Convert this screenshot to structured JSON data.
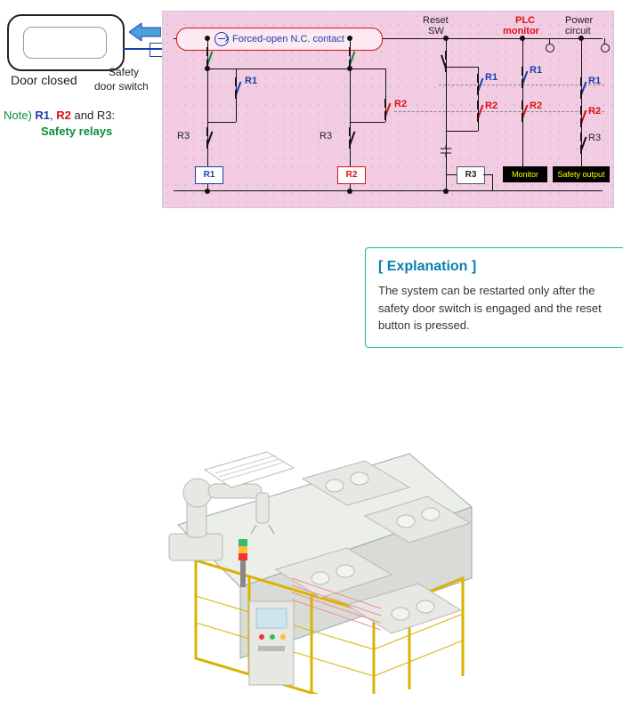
{
  "door": {
    "caption": "Door closed",
    "switch_label1": "Safety",
    "switch_label2": "door switch"
  },
  "note": {
    "prefix": "Note) ",
    "r1": "R1",
    "sep1": ", ",
    "r2": "R2",
    "sep2": " and ",
    "r3": "R3",
    "tail": ":",
    "line2": "Safety relays"
  },
  "circuit": {
    "forced_open": "Forced-open N.C. contact",
    "reset": "Reset",
    "sw": "SW",
    "plc": "PLC",
    "monitor_hdr": "monitor",
    "power": "Power",
    "circuit": "circuit",
    "r1": "R1",
    "r2": "R2",
    "r3": "R3",
    "monitor_box": "Monitor",
    "safety_box": "Safety output"
  },
  "explanation": {
    "title": "[ Explanation ]",
    "body": "The system can be restarted only after the safety door switch is engaged and the reset button is pressed."
  }
}
